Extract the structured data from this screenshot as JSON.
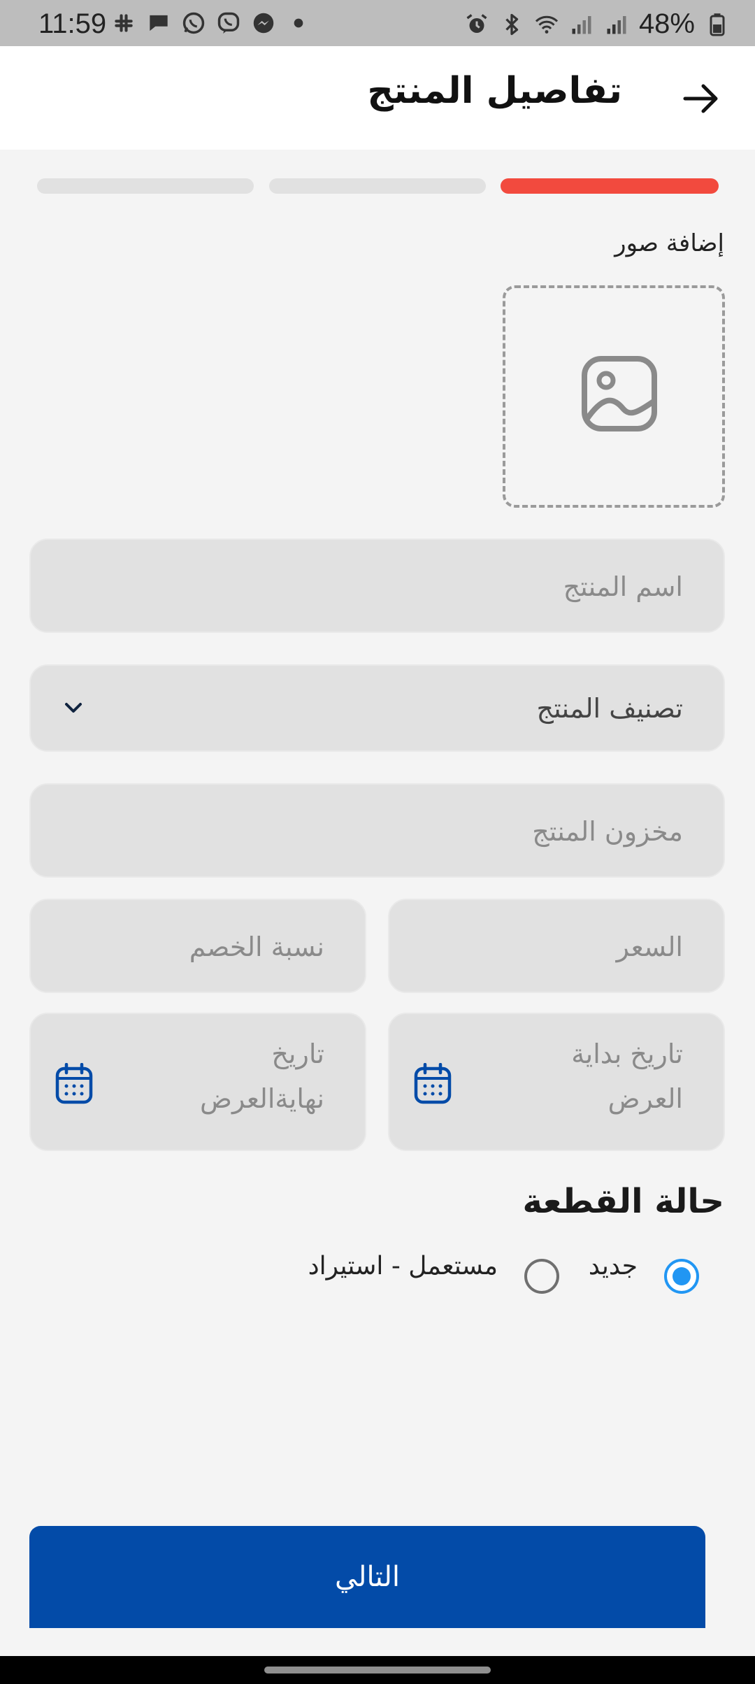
{
  "status_bar": {
    "time": "11:59",
    "battery": "48%",
    "app_icons": [
      "slack-icon",
      "chat-bubble-icon",
      "whatsapp-icon",
      "viber-icon",
      "messenger-icon",
      "dot-icon"
    ],
    "system_icons": [
      "alarm-icon",
      "bluetooth-icon",
      "wifi-icon",
      "signal-icon",
      "signal-icon",
      "battery-icon"
    ]
  },
  "header": {
    "title": "تفاصيل المنتج",
    "back_icon": "arrow-right-icon"
  },
  "progress": {
    "total_steps": 3,
    "current_step": 1,
    "active_color": "#f24a3e",
    "inactive_color": "#e1e1e1"
  },
  "form": {
    "add_photos_label": "إضافة صور",
    "product_name_placeholder": "اسم المنتج",
    "category_placeholder": "تصنيف المنتج",
    "stock_placeholder": "مخزون المنتج",
    "price_placeholder": "السعر",
    "discount_placeholder": "نسبة الخصم",
    "offer_start_line1": "تاريخ بداية",
    "offer_start_line2": "العرض",
    "offer_end_line1": "تاريخ",
    "offer_end_line2": "نهايةالعرض"
  },
  "condition": {
    "heading": "حالة القطعة",
    "options": [
      {
        "label": "جديد",
        "selected": true
      },
      {
        "label": "مستعمل - استيراد",
        "selected": false
      }
    ],
    "accent_color": "#2196f3"
  },
  "next_button": {
    "label": "التالي",
    "color": "#034ba8"
  }
}
